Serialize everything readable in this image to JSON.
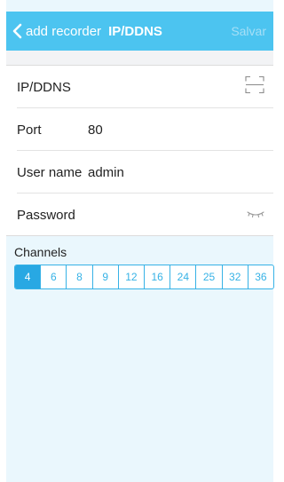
{
  "header": {
    "back_label": "add recorder",
    "title": "IP/DDNS",
    "save_label": "Salvar"
  },
  "form": {
    "ip": {
      "label": "IP/DDNS",
      "value": ""
    },
    "port": {
      "label": "Port",
      "value": "80"
    },
    "username": {
      "label": "User name",
      "value": "admin"
    },
    "password": {
      "label": "Password",
      "value": ""
    }
  },
  "channels": {
    "title": "Channels",
    "options": [
      "4",
      "6",
      "8",
      "9",
      "12",
      "16",
      "24",
      "25",
      "32",
      "36"
    ],
    "selected": "4"
  },
  "colors": {
    "accent": "#4cc4f0",
    "segment_selected": "#28a8e3",
    "background": "#eaf7fd"
  },
  "icons": {
    "scan": "scan-qr-icon",
    "password_toggle": "eye-closed-icon",
    "back": "chevron-left-icon"
  }
}
